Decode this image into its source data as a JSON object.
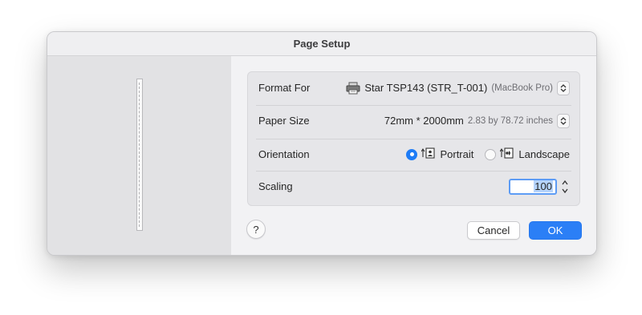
{
  "dialog": {
    "title": "Page Setup"
  },
  "settings": {
    "format_for": {
      "label": "Format For",
      "printer": "Star TSP143 (STR_T-001)",
      "sub": "(MacBook Pro)",
      "icon": "printer-icon"
    },
    "paper_size": {
      "label": "Paper Size",
      "value": "72mm * 2000mm",
      "sub": "2.83 by 78.72 inches"
    },
    "orientation": {
      "label": "Orientation",
      "selected": "Portrait",
      "options": [
        "Portrait",
        "Landscape"
      ]
    },
    "scaling": {
      "label": "Scaling",
      "value": "100"
    }
  },
  "buttons": {
    "help": "?",
    "cancel": "Cancel",
    "ok": "OK"
  },
  "colors": {
    "accent": "#2b7ff6",
    "dialog_bg": "#ececee"
  }
}
